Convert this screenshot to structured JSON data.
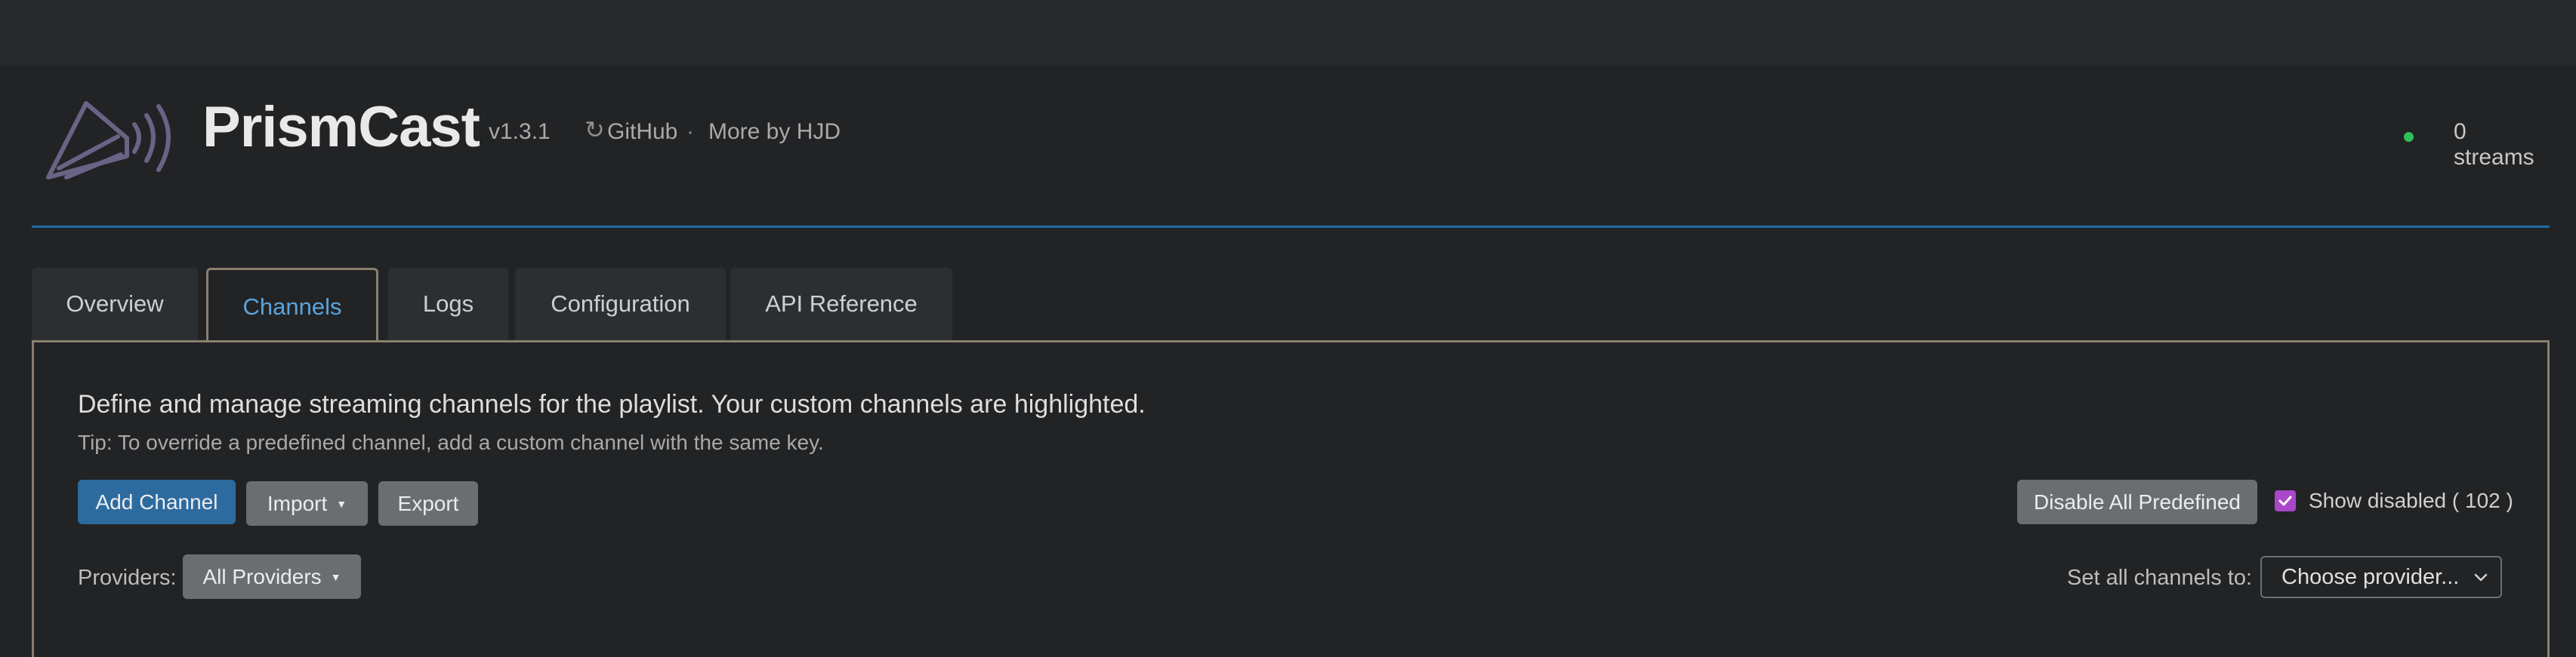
{
  "app": {
    "name": "PrismCast",
    "version": "v1.3.1",
    "refresh_icon": "↻",
    "github_link": "GitHub",
    "separator": "·",
    "more_link": "More by HJD",
    "stream_count": "0 streams",
    "status_color": "#2fbf5d"
  },
  "tabs": [
    {
      "label": "Overview",
      "active": false
    },
    {
      "label": "Channels",
      "active": true
    },
    {
      "label": "Logs",
      "active": false
    },
    {
      "label": "Configuration",
      "active": false
    },
    {
      "label": "API Reference",
      "active": false
    }
  ],
  "channels": {
    "description": "Define and manage streaming channels for the playlist. Your custom channels are highlighted.",
    "tip": "Tip: To override a predefined channel, add a custom channel with the same key.",
    "add_label": "Add Channel",
    "import_label": "Import",
    "export_label": "Export",
    "disable_all_label": "Disable All Predefined",
    "show_disabled_label": "Show disabled ( 102 )",
    "show_disabled_checked": true,
    "providers_label": "Providers:",
    "providers_value": "All Providers",
    "set_all_label": "Set all channels to:",
    "set_all_value": "Choose provider..."
  },
  "colors": {
    "accent": "#2d6b9f",
    "active_tab_text": "#5ba4dc",
    "checkbox": "#a947c9",
    "header_rule": "#1e6ea8"
  }
}
